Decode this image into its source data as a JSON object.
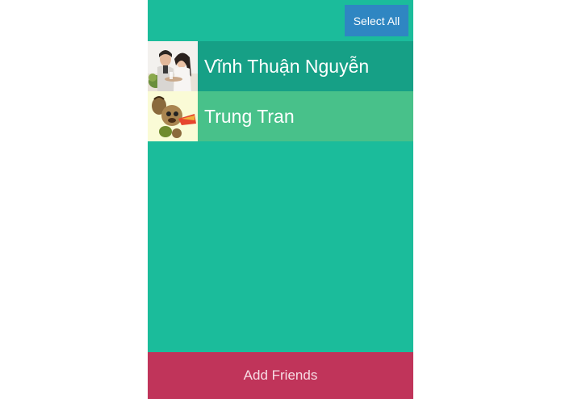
{
  "header": {
    "select_all_label": "Select All"
  },
  "friends": [
    {
      "name": "Vĩnh Thuận Nguyễn",
      "state": "selected",
      "avatar": "couple-photo"
    },
    {
      "name": "Trung Tran",
      "state": "unselected",
      "avatar": "cartoon-dog-image"
    }
  ],
  "footer": {
    "add_friends_label": "Add Friends"
  },
  "colors": {
    "background": "#1bbc9b",
    "select_all": "#2f86c2",
    "row_selected": "#16a086",
    "row_unselected": "#48c18a",
    "add_friends": "#c0345a"
  }
}
